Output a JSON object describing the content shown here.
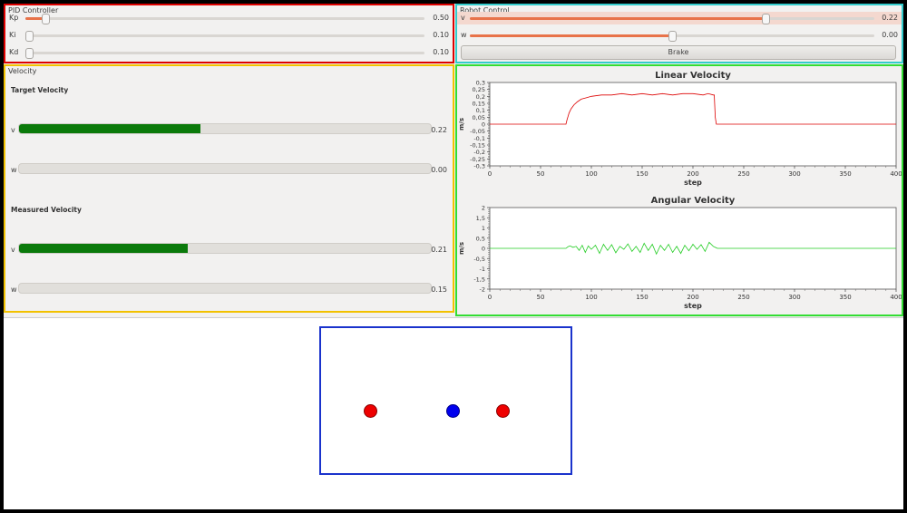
{
  "pid": {
    "title": "PID Controller",
    "sliders": [
      {
        "label": "Kp",
        "value": "0.50",
        "level": 0.05
      },
      {
        "label": "Ki",
        "value": "0.10",
        "level": 0.01
      },
      {
        "label": "Kd",
        "value": "0.10",
        "level": 0.01
      }
    ]
  },
  "robot": {
    "title": "Robot Control",
    "sliders": [
      {
        "label": "v",
        "value": "0.22",
        "level": 0.73
      },
      {
        "label": "w",
        "value": "0.00",
        "level": 0.5
      }
    ],
    "brake_label": "Brake"
  },
  "velocity": {
    "title": "Velocity",
    "target": {
      "heading": "Target Velocity",
      "v": {
        "label": "v",
        "value": "0.22",
        "level": 0.44
      },
      "w": {
        "label": "w",
        "value": "0.00",
        "level": 0.0
      }
    },
    "measured": {
      "heading": "Measured Velocity",
      "v": {
        "label": "v",
        "value": "0.21",
        "level": 0.41
      },
      "w": {
        "label": "w",
        "value": "0.15",
        "level": 0.0
      }
    }
  },
  "colors": {
    "pid_border": "#dd0000",
    "robot_border": "#33cccc",
    "velocity_border": "#f2c200",
    "plots_border": "#33dd33",
    "field_border": "#1a33cc",
    "slider_fill": "#e8734a",
    "progress_fill": "#0b7a0b",
    "linear_line": "#dd0000",
    "angular_line": "#22cc22"
  },
  "chart_data": [
    {
      "type": "line",
      "title": "Linear Velocity",
      "xlabel": "step",
      "ylabel": "m/s",
      "xlim": [
        0,
        400
      ],
      "ylim": [
        -0.3,
        0.3
      ],
      "xticks": [
        "0",
        "50",
        "100",
        "150",
        "200",
        "250",
        "300",
        "350",
        "400"
      ],
      "yticks": [
        "0,3",
        "0,25",
        "0,2",
        "0,15",
        "0,1",
        "0,05",
        "0",
        "-0,05",
        "-0,1",
        "-0,15",
        "-0,2",
        "-0,25",
        "-0,3"
      ],
      "series": [
        {
          "x": [
            0,
            75,
            76,
            78,
            80,
            83,
            86,
            90,
            95,
            100,
            110,
            120,
            130,
            140,
            150,
            160,
            170,
            180,
            190,
            200,
            210,
            215,
            220,
            221,
            222,
            223,
            225,
            300,
            400
          ],
          "y": [
            0,
            0,
            0.03,
            0.08,
            0.11,
            0.14,
            0.16,
            0.18,
            0.19,
            0.2,
            0.21,
            0.21,
            0.22,
            0.21,
            0.22,
            0.21,
            0.22,
            0.21,
            0.22,
            0.22,
            0.21,
            0.22,
            0.21,
            0.21,
            0.05,
            0,
            0,
            0,
            0
          ]
        }
      ]
    },
    {
      "type": "line",
      "title": "Angular Velocity",
      "xlabel": "step",
      "ylabel": "m/s",
      "xlim": [
        0,
        400
      ],
      "ylim": [
        -2,
        2
      ],
      "xticks": [
        "0",
        "50",
        "100",
        "150",
        "200",
        "250",
        "300",
        "350",
        "400"
      ],
      "yticks": [
        "2",
        "1,5",
        "1",
        "0,5",
        "0",
        "-0,5",
        "-1",
        "-1,5",
        "-2"
      ],
      "series": [
        {
          "x": [
            0,
            75,
            77,
            79,
            82,
            85,
            88,
            91,
            94,
            97,
            100,
            104,
            108,
            112,
            116,
            120,
            124,
            128,
            132,
            136,
            140,
            144,
            148,
            152,
            156,
            160,
            164,
            168,
            172,
            176,
            180,
            184,
            188,
            192,
            196,
            200,
            204,
            208,
            212,
            216,
            220,
            222,
            224,
            300,
            400
          ],
          "y": [
            0,
            0,
            0.08,
            0.12,
            0.05,
            0.1,
            -0.1,
            0.15,
            -0.2,
            0.12,
            -0.05,
            0.15,
            -0.25,
            0.2,
            -0.1,
            0.18,
            -0.22,
            0.1,
            -0.05,
            0.22,
            -0.15,
            0.1,
            -0.2,
            0.25,
            -0.1,
            0.2,
            -0.28,
            0.15,
            -0.1,
            0.2,
            -0.2,
            0.1,
            -0.25,
            0.15,
            -0.12,
            0.2,
            -0.05,
            0.18,
            -0.15,
            0.3,
            0.1,
            0.05,
            0,
            0,
            0
          ]
        }
      ]
    }
  ]
}
